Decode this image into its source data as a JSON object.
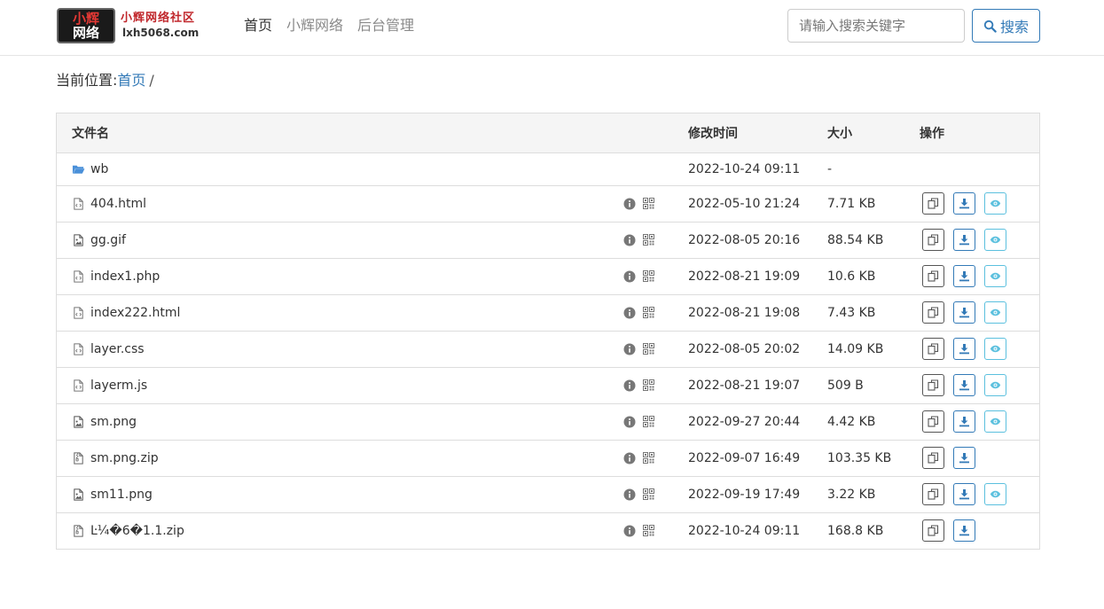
{
  "header": {
    "logo_badge_line1": "小辉",
    "logo_badge_line2": "网络",
    "logo_cn": "小辉网络社区",
    "logo_en": "lxh5068.com",
    "nav": [
      {
        "label": "首页",
        "active": true
      },
      {
        "label": "小辉网络",
        "active": false
      },
      {
        "label": "后台管理",
        "active": false
      }
    ],
    "search_placeholder": "请输入搜索关键字",
    "search_button": "搜索"
  },
  "breadcrumb": {
    "prefix": "当前位置:",
    "home": "首页",
    "separator": "/"
  },
  "table": {
    "columns": {
      "name": "文件名",
      "time": "修改时间",
      "size": "大小",
      "actions": "操作"
    },
    "rows": [
      {
        "name": "wb",
        "type": "folder",
        "time": "2022-10-24 09:11",
        "size": "-",
        "actions": []
      },
      {
        "name": "404.html",
        "type": "code",
        "time": "2022-05-10 21:24",
        "size": "7.71 KB",
        "actions": [
          "copy",
          "download",
          "view"
        ]
      },
      {
        "name": "gg.gif",
        "type": "image",
        "time": "2022-08-05 20:16",
        "size": "88.54 KB",
        "actions": [
          "copy",
          "download",
          "view"
        ]
      },
      {
        "name": "index1.php",
        "type": "code",
        "time": "2022-08-21 19:09",
        "size": "10.6 KB",
        "actions": [
          "copy",
          "download",
          "view"
        ]
      },
      {
        "name": "index222.html",
        "type": "code",
        "time": "2022-08-21 19:08",
        "size": "7.43 KB",
        "actions": [
          "copy",
          "download",
          "view"
        ]
      },
      {
        "name": "layer.css",
        "type": "code",
        "time": "2022-08-05 20:02",
        "size": "14.09 KB",
        "actions": [
          "copy",
          "download",
          "view"
        ]
      },
      {
        "name": "layerm.js",
        "type": "code",
        "time": "2022-08-21 19:07",
        "size": "509 B",
        "actions": [
          "copy",
          "download",
          "view"
        ]
      },
      {
        "name": "sm.png",
        "type": "image",
        "time": "2022-09-27 20:44",
        "size": "4.42 KB",
        "actions": [
          "copy",
          "download",
          "view"
        ]
      },
      {
        "name": "sm.png.zip",
        "type": "zip",
        "time": "2022-09-07 16:49",
        "size": "103.35 KB",
        "actions": [
          "copy",
          "download"
        ]
      },
      {
        "name": "sm11.png",
        "type": "image",
        "time": "2022-09-19 17:49",
        "size": "3.22 KB",
        "actions": [
          "copy",
          "download",
          "view"
        ]
      },
      {
        "name": "Ŀ¼�6�1.1.zip",
        "type": "zip",
        "time": "2022-10-24 09:11",
        "size": "168.8 KB",
        "actions": [
          "copy",
          "download"
        ]
      }
    ]
  },
  "colors": {
    "primary": "#337ab7",
    "info": "#5bc0de",
    "folder": "#4a90d9",
    "icon_gray": "#777777"
  }
}
